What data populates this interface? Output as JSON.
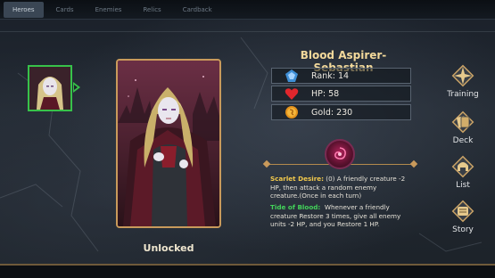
{
  "tabs": [
    {
      "label": "Heroes",
      "active": true
    },
    {
      "label": "Cards",
      "active": false
    },
    {
      "label": "Enemies",
      "active": false
    },
    {
      "label": "Relics",
      "active": false
    },
    {
      "label": "Cardback",
      "active": false
    }
  ],
  "hero": {
    "name": "Blood Aspirer-Sebastian",
    "status": "Unlocked",
    "stats": {
      "rank": "Rank: 14",
      "hp": "HP: 58",
      "gold": "Gold: 230"
    }
  },
  "skills": [
    {
      "name": "Scarlet Desire:",
      "cost": " (0) ",
      "text": "A friendly creature -2 HP, then attack a random enemy creature.(Once in each turn)"
    },
    {
      "name": "Tide of Blood:",
      "cost": "  ",
      "text": "Whenever a friendly creature Restore 3 times, give all enemy units -2 HP, and you Restore 1 HP."
    }
  ],
  "menu": {
    "training": "Training",
    "deck": "Deck",
    "list": "List",
    "story": "Story"
  },
  "colors": {
    "accent_gold": "#c99a5b",
    "name_gold": "#f3d99b",
    "selection_green": "#37c24a",
    "skill1_yellow": "#f2c94c",
    "skill2_green": "#43d35a"
  },
  "icons": {
    "rank": "blue-crest-icon",
    "hp": "red-heart-icon",
    "gold": "gold-coin-icon",
    "skill": "blood-vortex-icon",
    "training": "compass-star-icon",
    "deck": "cards-icon",
    "list": "helmet-icon",
    "story": "scroll-icon"
  }
}
